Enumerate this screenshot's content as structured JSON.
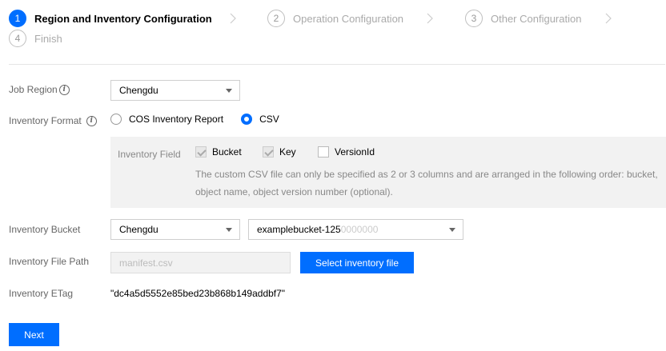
{
  "steps": [
    {
      "number": "1",
      "label": "Region and Inventory Configuration",
      "active": true
    },
    {
      "number": "2",
      "label": "Operation Configuration",
      "active": false
    },
    {
      "number": "3",
      "label": "Other Configuration",
      "active": false
    },
    {
      "number": "4",
      "label": "Finish",
      "active": false
    }
  ],
  "job_region": {
    "label": "Job Region",
    "value": "Chengdu"
  },
  "inventory_format": {
    "label": "Inventory Format",
    "options": [
      "COS Inventory Report",
      "CSV"
    ],
    "selected": "CSV"
  },
  "inventory_field": {
    "label": "Inventory Field",
    "checkboxes": [
      {
        "label": "Bucket",
        "checked": true,
        "disabled": true
      },
      {
        "label": "Key",
        "checked": true,
        "disabled": true
      },
      {
        "label": "VersionId",
        "checked": false,
        "disabled": false
      }
    ],
    "note": "The custom CSV file can only be specified as 2 or 3 columns and are arranged in the following order: bucket, object name, object version number (optional)."
  },
  "inventory_bucket": {
    "label": "Inventory Bucket",
    "region": "Chengdu",
    "bucket": "examplebucket-125",
    "bucket_masked": "0000000"
  },
  "inventory_file_path": {
    "label": "Inventory File Path",
    "placeholder": "manifest.csv",
    "button": "Select inventory file"
  },
  "inventory_etag": {
    "label": "Inventory ETag",
    "value": "\"dc4a5d5552e85bed23b868b149addbf7\""
  },
  "next_button": "Next",
  "colors": {
    "primary": "#006eff",
    "field_bg": "#f2f2f2"
  }
}
